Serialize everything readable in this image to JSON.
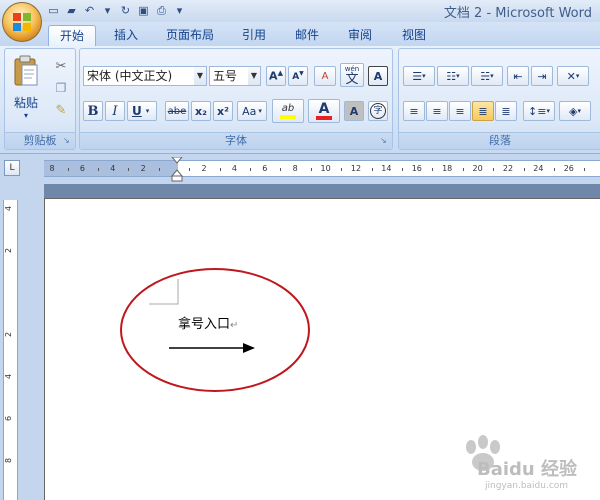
{
  "window": {
    "title": "文档 2 - Microsoft Word"
  },
  "quick_access": [
    {
      "name": "new-doc-icon",
      "glyph": "▭"
    },
    {
      "name": "open-folder-icon",
      "glyph": "▰"
    },
    {
      "name": "undo-icon",
      "glyph": "↶"
    },
    {
      "name": "undo-dropdown-icon",
      "glyph": "▾"
    },
    {
      "name": "redo-icon",
      "glyph": "↻"
    },
    {
      "name": "save-icon",
      "glyph": "▣"
    },
    {
      "name": "print-preview-icon",
      "glyph": "⎙"
    },
    {
      "name": "qat-customize-icon",
      "glyph": "▾"
    }
  ],
  "tabs": [
    "开始",
    "插入",
    "页面布局",
    "引用",
    "邮件",
    "审阅",
    "视图"
  ],
  "ribbon": {
    "clipboard": {
      "label": "剪贴板",
      "paste_label": "粘贴"
    },
    "font": {
      "label": "字体",
      "font_name": "宋体 (中文正文)",
      "font_size": "五号",
      "bold": "B",
      "italic": "I",
      "underline": "U",
      "strike": "abe",
      "subscript": "x₂",
      "superscript": "x²",
      "change_case": "Aa",
      "highlight": "ab",
      "font_color": "A",
      "grow": "A",
      "shrink": "A",
      "clear": "A",
      "phonetic": "wén",
      "char_border": "A",
      "char_shading": "A",
      "enclose": "字"
    },
    "paragraph": {
      "label": "段落"
    }
  },
  "ruler": {
    "h_numbers": [
      "8",
      "6",
      "4",
      "2",
      "",
      "2",
      "4",
      "6",
      "8",
      "10",
      "12",
      "14",
      "16",
      "18",
      "20",
      "22",
      "24",
      "26"
    ],
    "v_numbers": [
      "4",
      "2",
      "",
      "2",
      "4",
      "6",
      "8"
    ]
  },
  "document": {
    "text": "拿号入口",
    "para_mark": "↵"
  },
  "colors": {
    "ellipse": "#c0161e",
    "highlight_bar": "#ffff00",
    "font_color_bar": "#e8211c"
  },
  "watermark": {
    "text": "Baidu 经验",
    "url": "jingyan.baidu.com"
  }
}
